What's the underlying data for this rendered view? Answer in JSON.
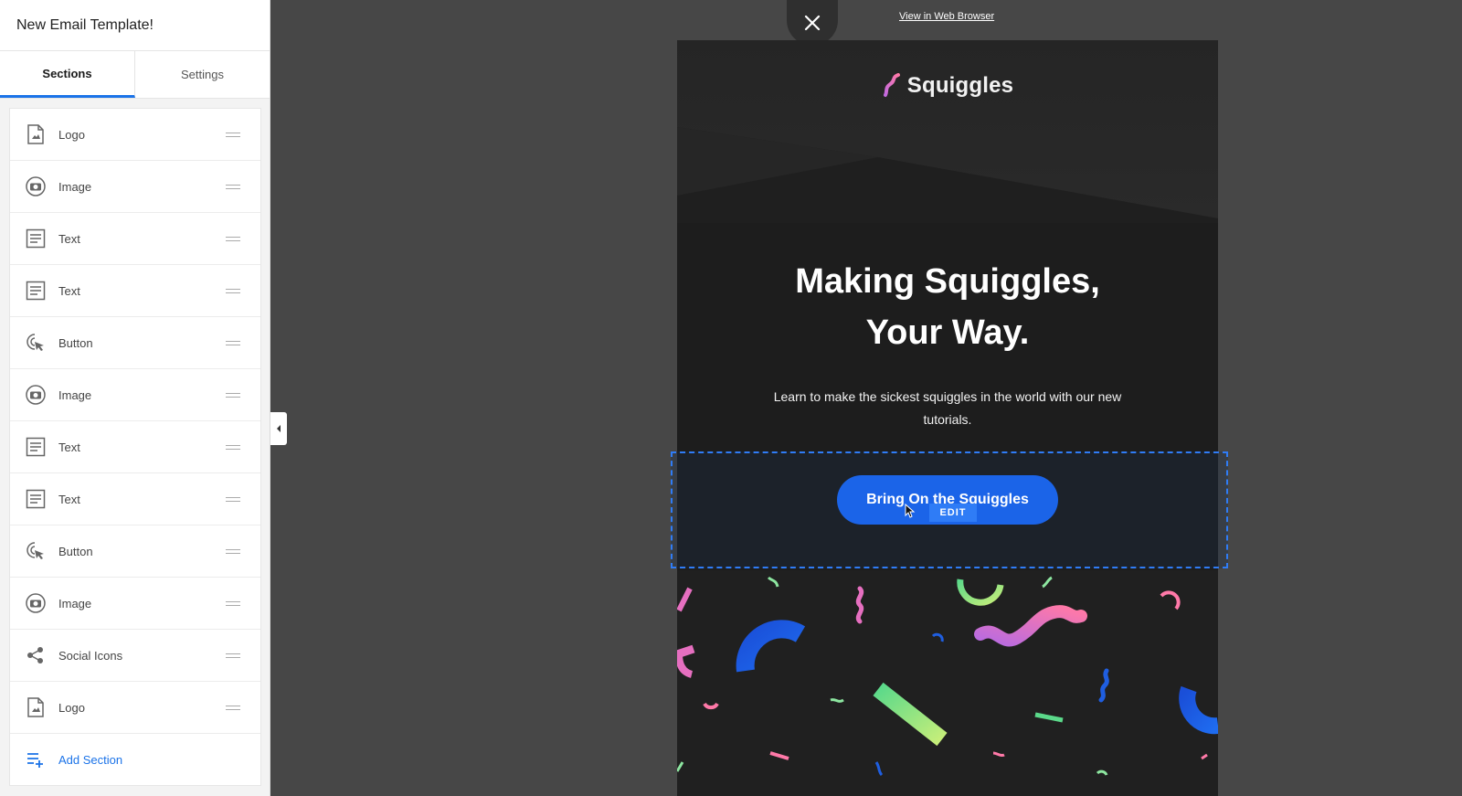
{
  "sidebar": {
    "title": "New Email Template!",
    "tabs": [
      {
        "label": "Sections",
        "active": true
      },
      {
        "label": "Settings",
        "active": false
      }
    ],
    "sections": [
      {
        "label": "Logo",
        "icon": "logo-icon"
      },
      {
        "label": "Image",
        "icon": "camera-icon"
      },
      {
        "label": "Text",
        "icon": "text-icon"
      },
      {
        "label": "Text",
        "icon": "text-icon"
      },
      {
        "label": "Button",
        "icon": "cursor-click-icon"
      },
      {
        "label": "Image",
        "icon": "camera-icon"
      },
      {
        "label": "Text",
        "icon": "text-icon"
      },
      {
        "label": "Text",
        "icon": "text-icon"
      },
      {
        "label": "Button",
        "icon": "cursor-click-icon"
      },
      {
        "label": "Image",
        "icon": "camera-icon"
      },
      {
        "label": "Social Icons",
        "icon": "share-icon"
      },
      {
        "label": "Logo",
        "icon": "logo-icon"
      }
    ],
    "add_section_label": "Add Section"
  },
  "preview": {
    "view_in_browser": "View in Web Browser",
    "logo_text": "Squiggles",
    "headline_line1": "Making Squiggles,",
    "headline_line2": "Your Way.",
    "body": "Learn to make the sickest squiggles in the world with our new tutorials.",
    "cta_label": "Bring On the Squiggles",
    "edit_badge": "EDIT"
  },
  "colors": {
    "accent": "#1b73e8",
    "cta": "#1b64e8",
    "canvas": "#474747",
    "email_bg": "#1d1d1d"
  }
}
